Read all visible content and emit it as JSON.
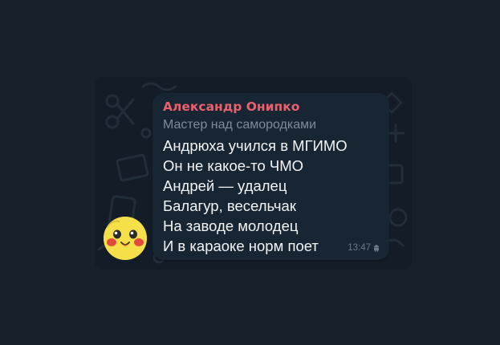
{
  "message": {
    "sender": "Александр Онипко",
    "sender_color": "#e8616d",
    "subtitle": "Мастер над самородками",
    "lines": [
      "Андрюха учился в МГИМО",
      "Он не какое-то ЧМО",
      "Андрей — удалец",
      "Балагур, весельчак",
      "На заводе молодец",
      "И в караоке норм поет"
    ],
    "time": "13:47",
    "client_icon": "android-icon"
  },
  "avatar": {
    "icon": "pikachu-avatar"
  },
  "colors": {
    "background": "#17212b",
    "bubble": "#182533",
    "text": "#f2f4f6",
    "muted": "#7f8a96"
  }
}
